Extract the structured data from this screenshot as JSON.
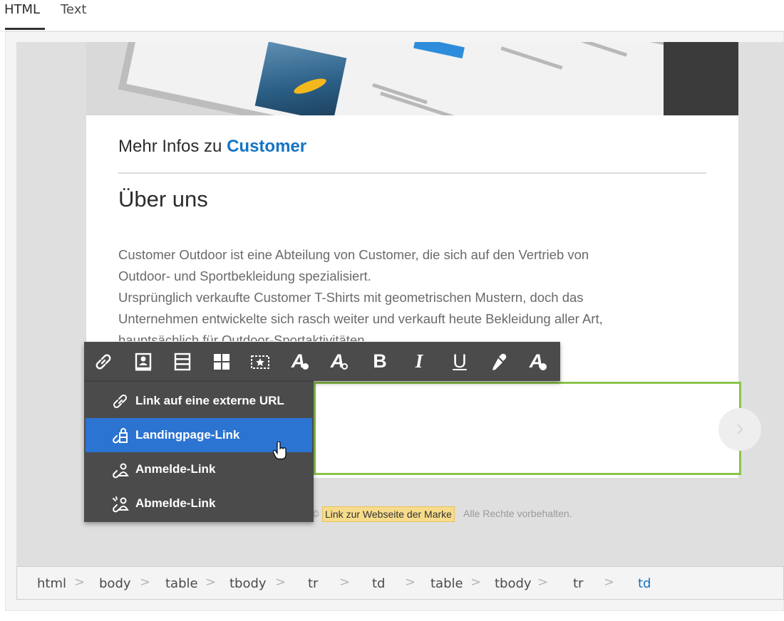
{
  "tabs": [
    {
      "label": "HTML",
      "active": true
    },
    {
      "label": "Text",
      "active": false
    }
  ],
  "email": {
    "more_info_prefix": "Mehr Infos zu",
    "more_info_brand": "Customer",
    "about_heading": "Über uns",
    "body_lines": [
      "Customer Outdoor ist eine Abteilung von Customer, die sich auf den Vertrieb von",
      "Outdoor- und Sportbekleidung spezialisiert.",
      "Ursprünglich verkaufte Customer T-Shirts mit geometrischen Mustern, doch das",
      "Unternehmen entwickelte sich rasch weiter und verkauft heute Bekleidung aller Art,",
      "hauptsächlich für Outdoor-Sportaktivitäten."
    ],
    "footer_copyright": "©",
    "brand_link": "Link zur Webseite der Marke",
    "rights": "Alle Rechte vorbehalten."
  },
  "toolbar": {
    "buttons": [
      {
        "icon": "link-icon"
      },
      {
        "icon": "personalization-icon"
      },
      {
        "icon": "content-block-icon"
      },
      {
        "icon": "structure-icon"
      },
      {
        "icon": "dynamic-content-icon"
      },
      {
        "icon": "text-color-icon"
      },
      {
        "icon": "background-color-icon"
      },
      {
        "icon": "bold-icon",
        "label": "B"
      },
      {
        "icon": "italic-icon",
        "label": "I"
      },
      {
        "icon": "underline-icon",
        "label": "U"
      },
      {
        "icon": "eyedropper-icon"
      },
      {
        "icon": "clear-format-icon"
      }
    ]
  },
  "link_menu": {
    "items": [
      {
        "label": "Link auf eine externe URL",
        "icon": "link-icon",
        "active": false
      },
      {
        "label": "Landingpage-Link",
        "icon": "landing-page-link-icon",
        "active": true
      },
      {
        "label": "Anmelde-Link",
        "icon": "subscription-link-icon",
        "active": false
      },
      {
        "label": "Abmelde-Link",
        "icon": "unsubscription-link-icon",
        "active": false
      }
    ]
  },
  "breadcrumb": {
    "items": [
      "html",
      "body",
      "table",
      "tbody",
      "tr",
      "td",
      "table",
      "tbody",
      "tr",
      "td"
    ],
    "current_index": 9
  },
  "colors": {
    "accent": "#1474c4",
    "selection": "#8bc34a",
    "menu_active": "#2c74d1",
    "toolbar": "#4b4b4b",
    "highlight": "#f7dc8b"
  }
}
